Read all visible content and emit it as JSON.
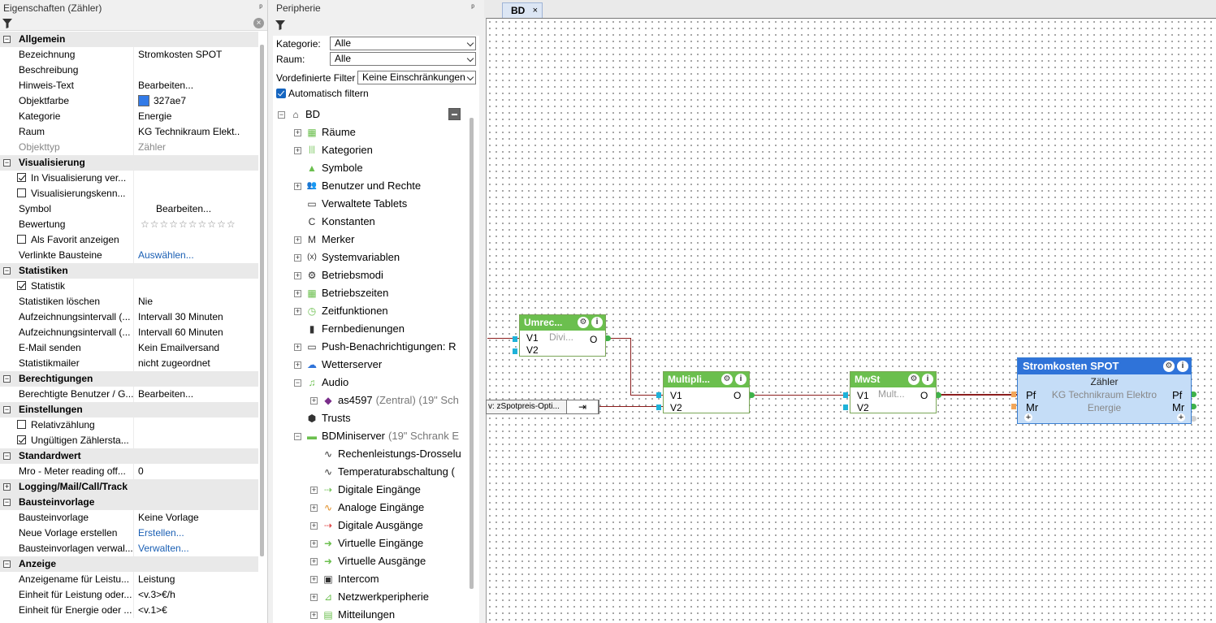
{
  "props_panel": {
    "title": "Eigenschaften (Zähler)",
    "pin": "ᵖ",
    "clear": "×",
    "sections": [
      {
        "title": "Allgemein",
        "rows": [
          {
            "k": "Bezeichnung",
            "v": "Stromkosten SPOT"
          },
          {
            "k": "Beschreibung",
            "v": ""
          },
          {
            "k": "Hinweis-Text",
            "v": "Bearbeiten..."
          },
          {
            "k": "Objektfarbe",
            "v": "327ae7"
          },
          {
            "k": "Kategorie",
            "v": "Energie"
          },
          {
            "k": "Raum",
            "v": "KG Technikraum Elekt..."
          },
          {
            "k": "Objekttyp",
            "v": "Zähler"
          }
        ]
      },
      {
        "title": "Visualisierung",
        "rows": [
          {
            "k": "In Visualisierung ver...",
            "v": ""
          },
          {
            "k": "Visualisierungskenn...",
            "v": ""
          },
          {
            "k": "Symbol",
            "v": "Bearbeiten..."
          },
          {
            "k": "Bewertung",
            "v": "☆☆☆☆☆☆☆☆☆☆"
          },
          {
            "k": "Als Favorit anzeigen",
            "v": ""
          },
          {
            "k": "Verlinkte Bausteine",
            "v": "Auswählen..."
          }
        ]
      },
      {
        "title": "Statistiken",
        "rows": [
          {
            "k": "Statistik",
            "v": ""
          },
          {
            "k": "Statistiken löschen",
            "v": "Nie"
          },
          {
            "k": "Aufzeichnungsintervall (...",
            "v": "Intervall 30 Minuten"
          },
          {
            "k": "Aufzeichnungsintervall (...",
            "v": "Intervall 60 Minuten"
          },
          {
            "k": "E-Mail senden",
            "v": "Kein Emailversand"
          },
          {
            "k": "Statistikmailer",
            "v": "nicht zugeordnet"
          }
        ]
      },
      {
        "title": "Berechtigungen",
        "rows": [
          {
            "k": "Berechtigte Benutzer / G...",
            "v": "Bearbeiten..."
          }
        ]
      },
      {
        "title": "Einstellungen",
        "rows": [
          {
            "k": "Relativzählung",
            "v": ""
          },
          {
            "k": "Ungültigen Zählersta...",
            "v": ""
          }
        ]
      },
      {
        "title": "Standardwert",
        "rows": [
          {
            "k": "Mro - Meter reading off...",
            "v": "0"
          }
        ]
      },
      {
        "title": "Logging/Mail/Call/Track",
        "rows": []
      },
      {
        "title": "Bausteinvorlage",
        "rows": [
          {
            "k": "Bausteinvorlage",
            "v": "Keine Vorlage"
          },
          {
            "k": "Neue Vorlage erstellen",
            "v": "Erstellen..."
          },
          {
            "k": "Bausteinvorlagen verwal...",
            "v": "Verwalten..."
          }
        ]
      },
      {
        "title": "Anzeige",
        "rows": [
          {
            "k": "Anzeigename für Leistu...",
            "v": "Leistung"
          },
          {
            "k": "Einheit für Leistung oder...",
            "v": "<v.3>€/h"
          },
          {
            "k": "Einheit für Energie oder ...",
            "v": "<v.1>€"
          }
        ]
      }
    ],
    "toggle_minus": "−",
    "toggle_plus": "+"
  },
  "periph_panel": {
    "title": "Peripherie",
    "kategorie_label": "Kategorie:",
    "kategorie_value": "Alle",
    "raum_label": "Raum:",
    "raum_value": "Alle",
    "filter_label": "Vordefinierte Filter",
    "filter_value": "Keine Einschränkungen",
    "auto_filter_label": "Automatisch filtern",
    "tree": [
      {
        "label": "BD",
        "level": 0,
        "exp": "−"
      },
      {
        "label": "Räume",
        "level": 1,
        "exp": "+"
      },
      {
        "label": "Kategorien",
        "level": 1,
        "exp": "+"
      },
      {
        "label": "Symbole",
        "level": 1,
        "exp": ""
      },
      {
        "label": "Benutzer und Rechte",
        "level": 1,
        "exp": "+"
      },
      {
        "label": "Verwaltete Tablets",
        "level": 1,
        "exp": ""
      },
      {
        "label": "Konstanten",
        "level": 1,
        "exp": ""
      },
      {
        "label": "Merker",
        "level": 1,
        "exp": "+"
      },
      {
        "label": "Systemvariablen",
        "level": 1,
        "exp": "+"
      },
      {
        "label": "Betriebsmodi",
        "level": 1,
        "exp": "+"
      },
      {
        "label": "Betriebszeiten",
        "level": 1,
        "exp": "+"
      },
      {
        "label": "Zeitfunktionen",
        "level": 1,
        "exp": "+"
      },
      {
        "label": "Fernbedienungen",
        "level": 1,
        "exp": ""
      },
      {
        "label": "Push-Benachrichtigungen: R",
        "level": 1,
        "exp": "+"
      },
      {
        "label": "Wetterserver",
        "level": 1,
        "exp": "+"
      },
      {
        "label": "Audio",
        "level": 1,
        "exp": "−"
      },
      {
        "label": "as4597",
        "extra": "(Zentral) (19\" Sch",
        "level": 2,
        "exp": "+"
      },
      {
        "label": "Trusts",
        "level": 1,
        "exp": ""
      },
      {
        "label": "BDMiniserver",
        "extra": "(19\" Schrank E",
        "level": 1,
        "exp": "−"
      },
      {
        "label": "Rechenleistungs-Drosselu",
        "level": 2,
        "exp": ""
      },
      {
        "label": "Temperaturabschaltung (",
        "level": 2,
        "exp": ""
      },
      {
        "label": "Digitale Eingänge",
        "level": 2,
        "exp": "+"
      },
      {
        "label": "Analoge Eingänge",
        "level": 2,
        "exp": "+"
      },
      {
        "label": "Digitale Ausgänge",
        "level": 2,
        "exp": "+"
      },
      {
        "label": "Virtuelle Eingänge",
        "level": 2,
        "exp": "+"
      },
      {
        "label": "Virtuelle Ausgänge",
        "level": 2,
        "exp": "+"
      },
      {
        "label": "Intercom",
        "level": 2,
        "exp": "+"
      },
      {
        "label": "Netzwerkperipherie",
        "level": 2,
        "exp": "+"
      },
      {
        "label": "Mitteilungen",
        "level": 2,
        "exp": "+"
      }
    ]
  },
  "canvas": {
    "tab_label": "BD",
    "tab_close": "×",
    "input_ref_label": "v: zSpotpreis-Opti...",
    "input_ref_icon": "⇥",
    "blocks": {
      "umrec": {
        "title": "Umrec...",
        "v1": "V1",
        "v2": "V2",
        "sub": "Divi...",
        "out": "O"
      },
      "multi": {
        "title": "Multipli...",
        "v1": "V1",
        "v2": "V2",
        "out": "O"
      },
      "mwst": {
        "title": "MwSt",
        "v1": "V1",
        "v2": "V2",
        "sub": "Mult...",
        "out": "O"
      },
      "spot": {
        "title": "Stromkosten SPOT",
        "type": "Zähler",
        "room": "KG Technikraum Elektro",
        "cat": "Energie",
        "pf": "Pf",
        "mr": "Mr",
        "plus": "+"
      }
    },
    "gear": "⚙",
    "info": "i"
  }
}
